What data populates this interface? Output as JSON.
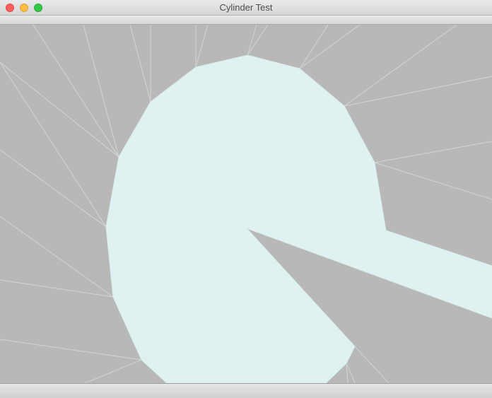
{
  "window": {
    "title": "Cylinder Test"
  },
  "colors": {
    "background": "#b8b8b8",
    "fill": "#dff2f1",
    "wireframe": "#d0d0d0"
  }
}
